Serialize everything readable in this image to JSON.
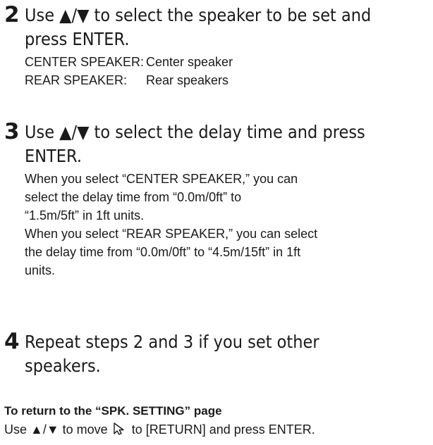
{
  "steps": [
    {
      "number": "2",
      "title_lines": [
        "Use ▲/▼ to select the speaker to be set and",
        "press ENTER."
      ],
      "speakers": [
        {
          "name": "CENTER SPEAKER:",
          "desc": "Center speaker"
        },
        {
          "name": "REAR SPEAKER:",
          "desc": "Rear speakers"
        }
      ]
    },
    {
      "number": "3",
      "title_lines": [
        "Use ▲/▼ to select the delay time and press",
        "ENTER."
      ],
      "body_lines": [
        "When you select “CENTER SPEAKER,” you can",
        "select the delay time from “0.0m/0ft” to",
        "“1.5m/5ft” in 1ft units.",
        "When you select “REAR SPEAKER,” you can select",
        "the delay time from “0.0m/0ft” to “4.5m/15ft” in 1ft",
        "units."
      ]
    },
    {
      "number": "4",
      "title_lines": [
        "Repeat steps 2 and 3 if you set other",
        "speakers."
      ]
    }
  ],
  "return_section": {
    "title": "To return to the “SPK. SETTING” page",
    "text_before": "Use ▲/▼ to move",
    "icon": "cursor-arrow-icon",
    "text_after": "to [RETURN] and press ENTER."
  }
}
